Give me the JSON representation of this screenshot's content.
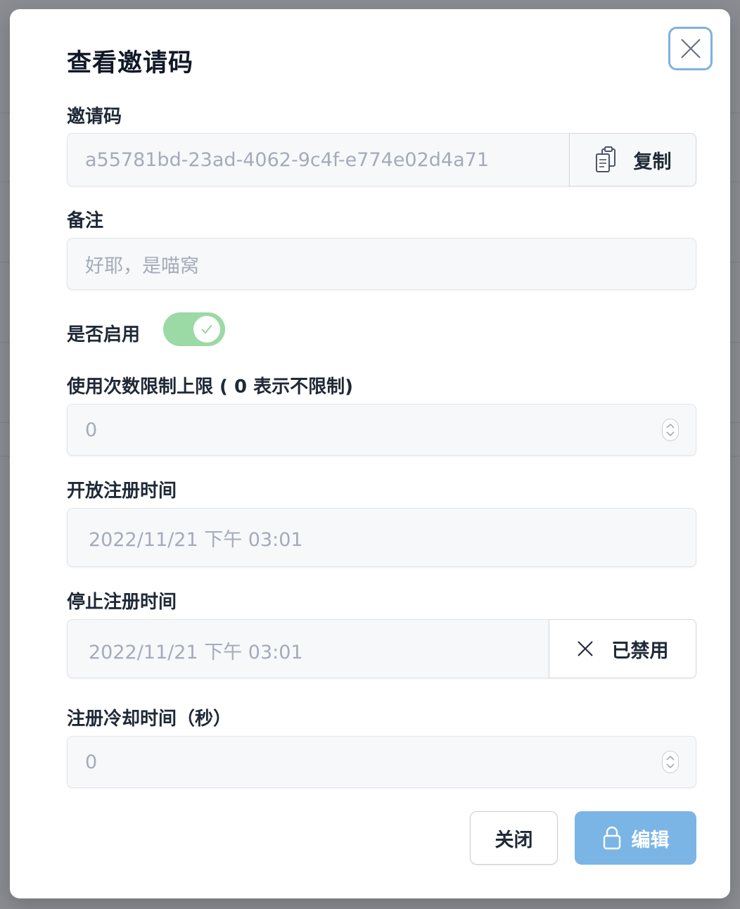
{
  "modal": {
    "title": "查看邀请码",
    "close_icon": "close-icon"
  },
  "invite_code": {
    "label": "邀请码",
    "value": "a55781bd-23ad-4062-9c4f-e774e02d4a71",
    "copy_label": "复制",
    "copy_icon": "clipboard-icon"
  },
  "note": {
    "label": "备注",
    "value": "好耶，是喵窝"
  },
  "enabled": {
    "label": "是否启用",
    "checked": true,
    "icon": "check-icon"
  },
  "usage_limit": {
    "label": "使用次数限制上限 ( 0 表示不限制)",
    "value": "0"
  },
  "open_time": {
    "label": "开放注册时间",
    "value": "2022/11/21 下午 03:01"
  },
  "close_time": {
    "label": "停止注册时间",
    "value": "2022/11/21 下午 03:01",
    "toggle_label": "已禁用",
    "toggle_icon": "x-icon"
  },
  "cooldown": {
    "label": "注册冷却时间（秒）",
    "value": "0"
  },
  "footer": {
    "close_label": "关闭",
    "edit_label": "编辑",
    "edit_icon": "lock-icon"
  },
  "colors": {
    "accent": "#7ab5e6",
    "toggle_on": "#9bd9a5",
    "overlay": "#86888d"
  }
}
